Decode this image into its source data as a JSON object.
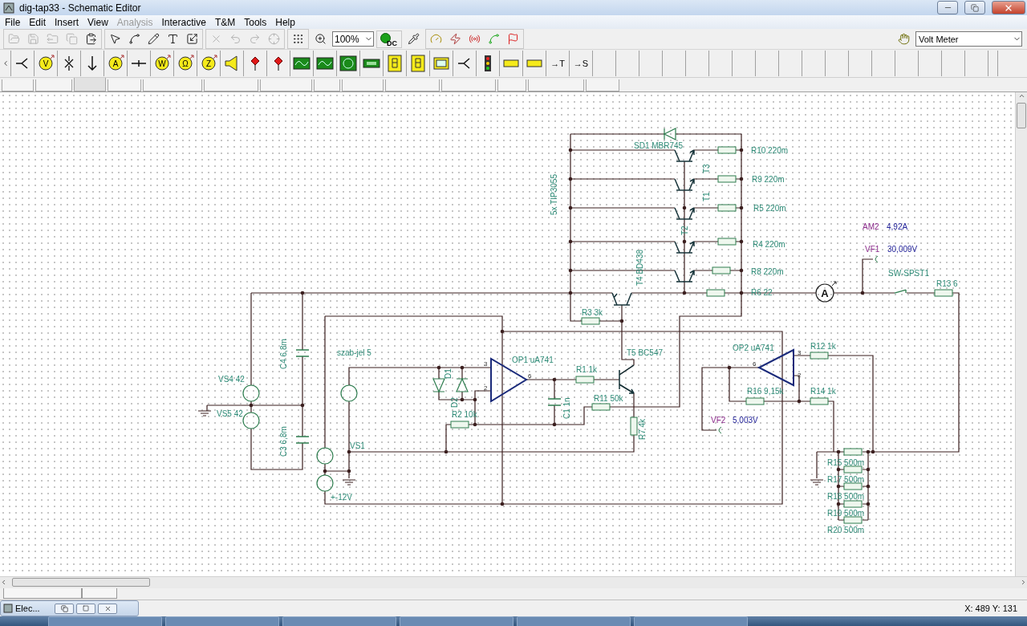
{
  "window": {
    "title": "dig-tap33 - Schematic Editor"
  },
  "menu": [
    {
      "label": "File",
      "disabled": false
    },
    {
      "label": "Edit",
      "disabled": false
    },
    {
      "label": "Insert",
      "disabled": false
    },
    {
      "label": "View",
      "disabled": false
    },
    {
      "label": "Analysis",
      "disabled": true
    },
    {
      "label": "Interactive",
      "disabled": false
    },
    {
      "label": "T&M",
      "disabled": false
    },
    {
      "label": "Tools",
      "disabled": false
    },
    {
      "label": "Help",
      "disabled": false
    }
  ],
  "toolbar": {
    "zoom": "100%",
    "mode_badge": "DC",
    "instrument": "Volt Meter"
  },
  "palette": [
    {
      "kind": "junction"
    },
    {
      "kind": "meter",
      "text": "V"
    },
    {
      "kind": "switch"
    },
    {
      "kind": "arrow-down"
    },
    {
      "kind": "meter",
      "text": "A"
    },
    {
      "kind": "wire"
    },
    {
      "kind": "meter",
      "text": "W"
    },
    {
      "kind": "meter",
      "text": "Ω"
    },
    {
      "kind": "meter",
      "text": "Z"
    },
    {
      "kind": "speaker"
    },
    {
      "kind": "probe"
    },
    {
      "kind": "probe"
    },
    {
      "kind": "scope"
    },
    {
      "kind": "scope"
    },
    {
      "kind": "screen"
    },
    {
      "kind": "display"
    },
    {
      "kind": "segment"
    },
    {
      "kind": "segment"
    },
    {
      "kind": "chip"
    },
    {
      "kind": "junction"
    },
    {
      "kind": "traffic-light"
    },
    {
      "kind": "tag"
    },
    {
      "kind": "tag"
    },
    {
      "kind": "text",
      "text": "→T"
    },
    {
      "kind": "text",
      "text": "→S"
    }
  ],
  "palette_tabs": [
    {
      "selected": false
    },
    {
      "selected": false
    },
    {
      "selected": true
    },
    {
      "selected": false
    },
    {
      "selected": false
    },
    {
      "selected": false
    },
    {
      "selected": false
    },
    {
      "selected": false
    },
    {
      "selected": false
    },
    {
      "selected": false
    },
    {
      "selected": false
    },
    {
      "selected": false
    },
    {
      "selected": false
    },
    {
      "selected": false
    }
  ],
  "schematic": {
    "labels": [
      {
        "kind": "label",
        "text": "SD1 MBR745"
      },
      {
        "kind": "label",
        "text": "R10 220m"
      },
      {
        "kind": "label",
        "text": "T3"
      },
      {
        "kind": "label",
        "text": "R9 220m"
      },
      {
        "kind": "label",
        "text": "5x TIP3055"
      },
      {
        "kind": "label",
        "text": "T1"
      },
      {
        "kind": "label",
        "text": "R5 220m"
      },
      {
        "kind": "meter-name",
        "text": "AM2"
      },
      {
        "kind": "reading",
        "text": "4,92A"
      },
      {
        "kind": "label",
        "text": "T2"
      },
      {
        "kind": "label",
        "text": "R4 220m"
      },
      {
        "kind": "meter-name",
        "text": "VF1"
      },
      {
        "kind": "reading",
        "text": "30,009V"
      },
      {
        "kind": "label",
        "text": "T4 BD438"
      },
      {
        "kind": "label",
        "text": "R8 220m"
      },
      {
        "kind": "label",
        "text": "SW-SPST1"
      },
      {
        "kind": "label",
        "text": "R13 6"
      },
      {
        "kind": "label",
        "text": "R6 22"
      },
      {
        "kind": "label",
        "text": "R3 3k"
      },
      {
        "kind": "label",
        "text": "C4 6,8m"
      },
      {
        "kind": "label",
        "text": "szab-jel 5"
      },
      {
        "kind": "label",
        "text": "T5 BC547"
      },
      {
        "kind": "label",
        "text": "OP1 uA741"
      },
      {
        "kind": "label",
        "text": "OP2 uA741"
      },
      {
        "kind": "label",
        "text": "R12 1k"
      },
      {
        "kind": "pin",
        "text": "3"
      },
      {
        "kind": "pin",
        "text": "6"
      },
      {
        "kind": "pin",
        "text": "2"
      },
      {
        "kind": "pin",
        "text": "6"
      },
      {
        "kind": "pin",
        "text": "3"
      },
      {
        "kind": "pin",
        "text": "2"
      },
      {
        "kind": "label",
        "text": "D1"
      },
      {
        "kind": "label",
        "text": "R1 1k"
      },
      {
        "kind": "label",
        "text": "VS4 42"
      },
      {
        "kind": "label",
        "text": "D2"
      },
      {
        "kind": "label",
        "text": "R11 50k"
      },
      {
        "kind": "label",
        "text": "R16 9,15k"
      },
      {
        "kind": "label",
        "text": "R14 1k"
      },
      {
        "kind": "label",
        "text": "VS5 42"
      },
      {
        "kind": "label",
        "text": "R2 10k"
      },
      {
        "kind": "label",
        "text": "C1 1n"
      },
      {
        "kind": "meter-name",
        "text": "VF2"
      },
      {
        "kind": "reading",
        "text": "5,003V"
      },
      {
        "kind": "label",
        "text": "R7 4k"
      },
      {
        "kind": "label",
        "text": "C3 6,8m"
      },
      {
        "kind": "label",
        "text": "VS1"
      },
      {
        "kind": "label",
        "text": "R15 500m"
      },
      {
        "kind": "label",
        "text": "R17 500m"
      },
      {
        "kind": "label",
        "text": "R18 500m"
      },
      {
        "kind": "label",
        "text": "R19 500m"
      },
      {
        "kind": "label",
        "text": "+-12V"
      },
      {
        "kind": "label",
        "text": "R20 500m"
      },
      {
        "kind": "letter",
        "text": "A"
      }
    ]
  },
  "minimized_window": {
    "title": "Elec..."
  },
  "status_bar": {
    "coordinates": "X: 489 Y: 131"
  }
}
